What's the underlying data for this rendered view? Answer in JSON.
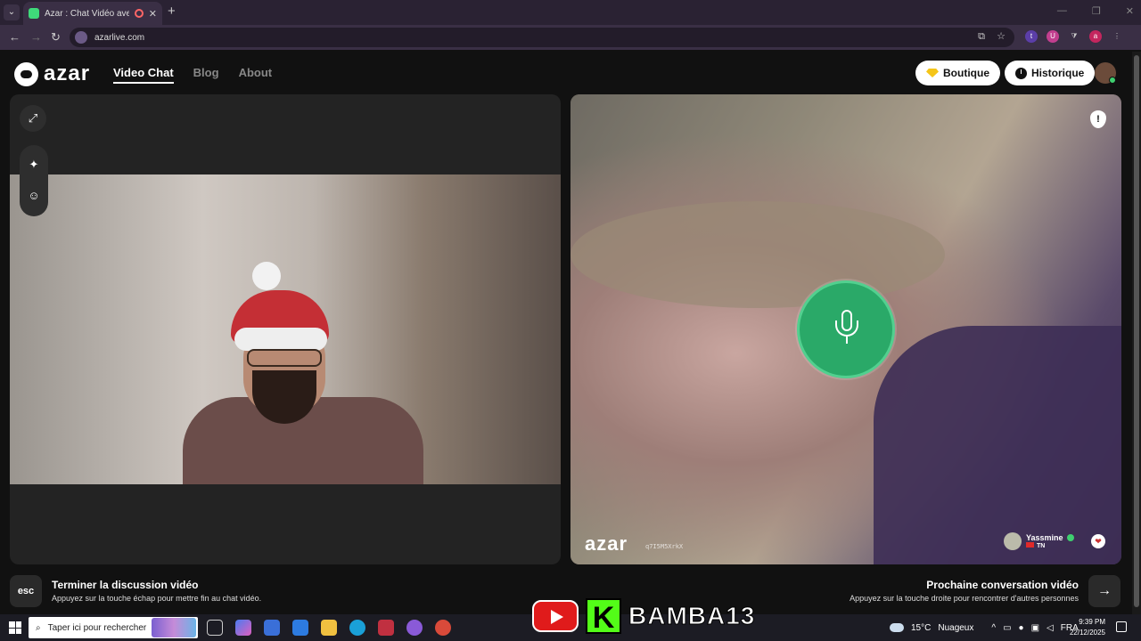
{
  "browser": {
    "tab_title": "Azar : Chat Vidéo avec de n",
    "url": "azarlive.com",
    "extensions": [
      {
        "label": "t",
        "color": "#5b3ea8"
      },
      {
        "label": "U",
        "color": "#c23f8f"
      },
      {
        "label": "a",
        "color": "#c4265e"
      }
    ]
  },
  "header": {
    "logo_text": "azar",
    "nav": [
      "Video Chat",
      "Blog",
      "About"
    ],
    "active_nav": "Video Chat",
    "shop_label": "Boutique",
    "history_label": "Historique"
  },
  "remote": {
    "watermark": "azar",
    "session_id": "q7I5M5XrkX",
    "peer_name": "Yassmine",
    "peer_country": "TN"
  },
  "controls": {
    "esc_key": "esc",
    "end_title": "Terminer la discussion vidéo",
    "end_subtitle": "Appuyez sur la touche échap pour mettre fin au chat vidéo.",
    "next_title": "Prochaine conversation vidéo",
    "next_subtitle": "Appuyez sur la touche droite pour rencontrer d'autres personnes"
  },
  "taskbar": {
    "search_placeholder": "Taper ici pour rechercher",
    "overlay_text": "BAMBA13",
    "weather": "15°C",
    "weather_desc": "Nuageux",
    "language": "FRA",
    "time": "9:39 PM",
    "date": "22/12/2025"
  },
  "colors": {
    "accent_green": "#2aa968",
    "kick_green": "#53fc18",
    "youtube_red": "#e01b1b",
    "gem_yellow": "#f5c518"
  }
}
